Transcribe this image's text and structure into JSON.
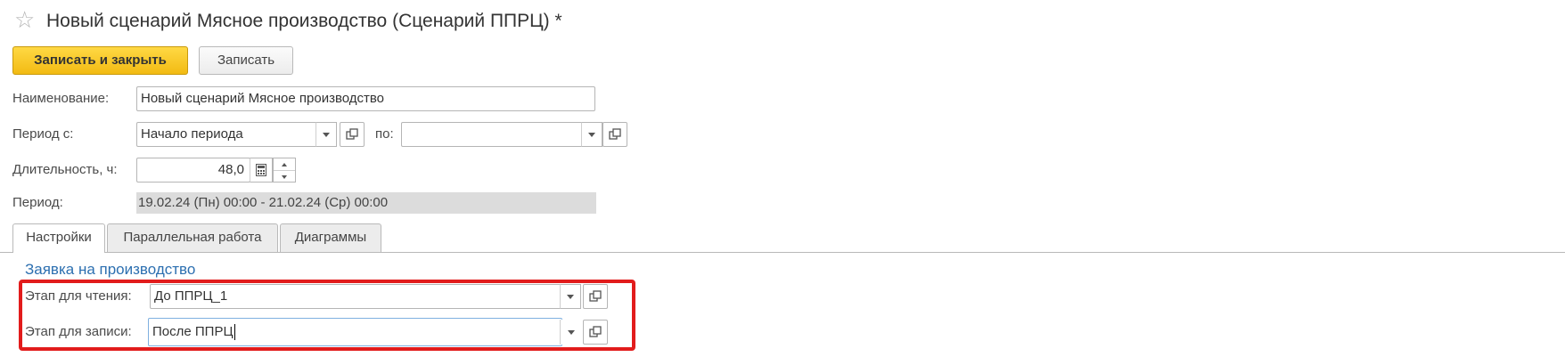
{
  "window": {
    "title": "Новый сценарий Мясное производство (Сценарий ППРЦ) *"
  },
  "toolbar": {
    "save_close_label": "Записать и закрыть",
    "save_label": "Записать"
  },
  "form": {
    "name_label": "Наименование:",
    "name_value": "Новый сценарий Мясное производство",
    "period_from_label": "Период с:",
    "period_from_value": "Начало периода",
    "period_to_label": "по:",
    "period_to_value": "",
    "duration_label": "Длительность, ч:",
    "duration_value": "48,0",
    "period_label": "Период:",
    "period_value": "19.02.24 (Пн) 00:00 - 21.02.24 (Ср) 00:00"
  },
  "tabs": [
    {
      "label": "Настройки",
      "active": true
    },
    {
      "label": "Параллельная работа",
      "active": false
    },
    {
      "label": "Диаграммы",
      "active": false
    }
  ],
  "settings": {
    "section_title": "Заявка на производство",
    "read_stage_label": "Этап для чтения:",
    "read_stage_value": "До ППРЦ_1",
    "write_stage_label": "Этап для записи:",
    "write_stage_value": "После ППРЦ"
  },
  "icons": {
    "star": "star-outline-icon",
    "dropdown": "chevron-down-icon",
    "open": "open-form-icon",
    "calculator": "calculator-icon",
    "spin": "spin-up-down-icon"
  },
  "colors": {
    "primary_button": "#f5c01a",
    "section_title": "#2c6fb0",
    "highlight_frame": "#e21c1c",
    "readonly_bg": "#dcdcdc"
  }
}
